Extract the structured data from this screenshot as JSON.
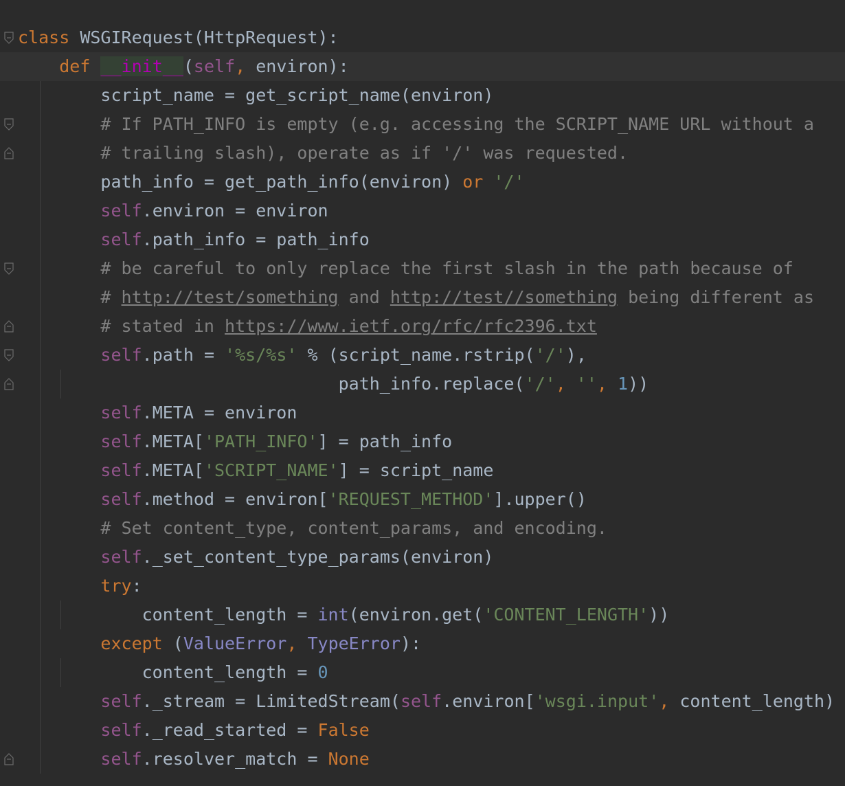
{
  "editor": {
    "colors": {
      "background": "#2b2b2b",
      "current_line": "#323232",
      "default_text": "#a9b7c6",
      "keyword": "#cc7832",
      "string": "#6a8759",
      "comment": "#808080",
      "self": "#94558d",
      "number": "#6897bb",
      "builtin": "#8888c6",
      "magic_method": "#b200b2"
    },
    "fold_markers": [
      {
        "icon": "fold-collapse-icon",
        "line": 0
      },
      {
        "icon": "fold-collapse-icon",
        "line": 1
      },
      {
        "icon": "fold-collapse-icon",
        "line": 3
      },
      {
        "icon": "fold-end-icon",
        "line": 4
      },
      {
        "icon": "fold-collapse-icon",
        "line": 8
      },
      {
        "icon": "fold-end-icon",
        "line": 10
      },
      {
        "icon": "fold-collapse-icon",
        "line": 11
      },
      {
        "icon": "fold-end-icon",
        "line": 12
      },
      {
        "icon": "fold-end-icon",
        "line": 25
      }
    ],
    "lines": [
      {
        "indent": "",
        "tokens": [
          [
            "kw",
            "class"
          ],
          [
            "plain",
            " WSGIRequest(HttpRequest):"
          ]
        ]
      },
      {
        "indent": "    ",
        "current": true,
        "tokens": [
          [
            "kw",
            "def "
          ],
          [
            "fnname",
            "__init__"
          ],
          [
            "plain",
            "("
          ],
          [
            "slf",
            "self"
          ],
          [
            "kw",
            ","
          ],
          [
            "plain",
            " environ):"
          ]
        ]
      },
      {
        "indent": "        ",
        "tokens": [
          [
            "plain",
            "script_name = get_script_name(environ)"
          ]
        ]
      },
      {
        "indent": "        ",
        "tokens": [
          [
            "cm",
            "# If PATH_INFO is empty (e.g. accessing the SCRIPT_NAME URL without a"
          ]
        ]
      },
      {
        "indent": "        ",
        "tokens": [
          [
            "cm",
            "# trailing slash), operate as if '/' was requested."
          ]
        ]
      },
      {
        "indent": "        ",
        "tokens": [
          [
            "plain",
            "path_info = get_path_info(environ) "
          ],
          [
            "kw",
            "or "
          ],
          [
            "st",
            "'/'"
          ]
        ]
      },
      {
        "indent": "        ",
        "tokens": [
          [
            "slf",
            "self"
          ],
          [
            "plain",
            ".environ = environ"
          ]
        ]
      },
      {
        "indent": "        ",
        "tokens": [
          [
            "slf",
            "self"
          ],
          [
            "plain",
            ".path_info = path_info"
          ]
        ]
      },
      {
        "indent": "        ",
        "tokens": [
          [
            "cm",
            "# be careful to only replace the first slash in the path because of"
          ]
        ]
      },
      {
        "indent": "        ",
        "tokens": [
          [
            "cm",
            "# "
          ],
          [
            "cm-link",
            "http://test/something"
          ],
          [
            "cm",
            " and "
          ],
          [
            "cm-link",
            "http://test//something"
          ],
          [
            "cm",
            " being different as"
          ]
        ]
      },
      {
        "indent": "        ",
        "tokens": [
          [
            "cm",
            "# stated in "
          ],
          [
            "cm-link",
            "https://www.ietf.org/rfc/rfc2396.txt"
          ]
        ]
      },
      {
        "indent": "        ",
        "tokens": [
          [
            "slf",
            "self"
          ],
          [
            "plain",
            ".path = "
          ],
          [
            "st",
            "'%s/%s'"
          ],
          [
            "plain",
            " % (script_name.rstrip("
          ],
          [
            "st",
            "'/'"
          ],
          [
            "plain",
            "),"
          ]
        ]
      },
      {
        "indent": "                               ",
        "tokens": [
          [
            "plain",
            "path_info.replace("
          ],
          [
            "st",
            "'/'"
          ],
          [
            "kw",
            ", "
          ],
          [
            "st",
            "''"
          ],
          [
            "kw",
            ", "
          ],
          [
            "num",
            "1"
          ],
          [
            "plain",
            "))"
          ]
        ]
      },
      {
        "indent": "        ",
        "tokens": [
          [
            "slf",
            "self"
          ],
          [
            "plain",
            ".META = environ"
          ]
        ]
      },
      {
        "indent": "        ",
        "tokens": [
          [
            "slf",
            "self"
          ],
          [
            "plain",
            ".META["
          ],
          [
            "st",
            "'PATH_INFO'"
          ],
          [
            "plain",
            "] = path_info"
          ]
        ]
      },
      {
        "indent": "        ",
        "tokens": [
          [
            "slf",
            "self"
          ],
          [
            "plain",
            ".META["
          ],
          [
            "st",
            "'SCRIPT_NAME'"
          ],
          [
            "plain",
            "] = script_name"
          ]
        ]
      },
      {
        "indent": "        ",
        "tokens": [
          [
            "slf",
            "self"
          ],
          [
            "plain",
            ".method = environ["
          ],
          [
            "st",
            "'REQUEST_METHOD'"
          ],
          [
            "plain",
            "].upper()"
          ]
        ]
      },
      {
        "indent": "        ",
        "tokens": [
          [
            "cm",
            "# Set content_type, content_params, and encoding."
          ]
        ]
      },
      {
        "indent": "        ",
        "tokens": [
          [
            "slf",
            "self"
          ],
          [
            "plain",
            "._set_content_type_params(environ)"
          ]
        ]
      },
      {
        "indent": "        ",
        "tokens": [
          [
            "kw",
            "try"
          ],
          [
            "plain",
            ":"
          ]
        ]
      },
      {
        "indent": "            ",
        "tokens": [
          [
            "plain",
            "content_length = "
          ],
          [
            "bi",
            "int"
          ],
          [
            "plain",
            "(environ.get("
          ],
          [
            "st",
            "'CONTENT_LENGTH'"
          ],
          [
            "plain",
            "))"
          ]
        ]
      },
      {
        "indent": "        ",
        "tokens": [
          [
            "kw",
            "except "
          ],
          [
            "plain",
            "("
          ],
          [
            "bi",
            "ValueError"
          ],
          [
            "kw",
            ", "
          ],
          [
            "bi",
            "TypeError"
          ],
          [
            "plain",
            "):"
          ]
        ]
      },
      {
        "indent": "            ",
        "tokens": [
          [
            "plain",
            "content_length = "
          ],
          [
            "num",
            "0"
          ]
        ]
      },
      {
        "indent": "        ",
        "tokens": [
          [
            "slf",
            "self"
          ],
          [
            "plain",
            "._stream = LimitedStream("
          ],
          [
            "slf",
            "self"
          ],
          [
            "plain",
            ".environ["
          ],
          [
            "st",
            "'wsgi.input'"
          ],
          [
            "kw",
            ", "
          ],
          [
            "plain",
            "content_length)"
          ]
        ]
      },
      {
        "indent": "        ",
        "tokens": [
          [
            "slf",
            "self"
          ],
          [
            "plain",
            "._read_started = "
          ],
          [
            "kw",
            "False"
          ]
        ]
      },
      {
        "indent": "        ",
        "tokens": [
          [
            "slf",
            "self"
          ],
          [
            "plain",
            ".resolver_match = "
          ],
          [
            "kw",
            "None"
          ]
        ]
      }
    ]
  }
}
